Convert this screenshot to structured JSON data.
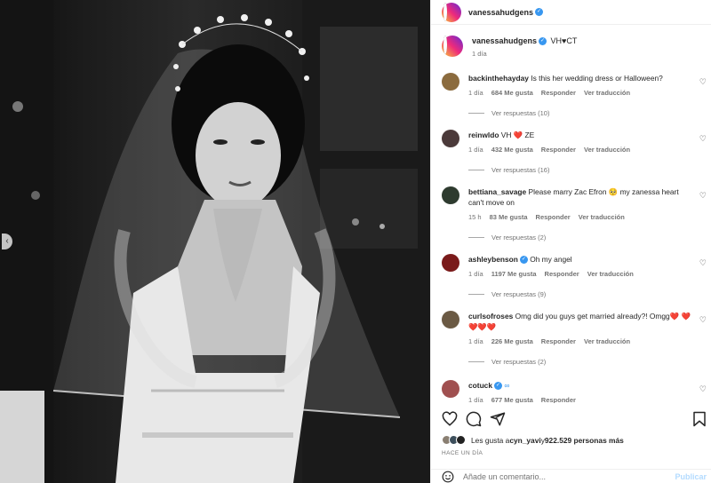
{
  "header": {
    "username": "vanessahudgens",
    "verified": true
  },
  "caption": {
    "username": "vanessahudgens",
    "text": "VH♥CT",
    "time": "1 día"
  },
  "comments": [
    {
      "username": "backinthehayday",
      "verified": false,
      "text": "Is this her wedding dress or Halloween?",
      "time": "1 día",
      "likes": "684 Me gusta",
      "reply": "Responder",
      "translate": "Ver traducción",
      "replies": "Ver respuestas (10)",
      "avatar_color": "#8b6b3e"
    },
    {
      "username": "reinwldo",
      "verified": false,
      "text": "VH ❤️ ZE",
      "time": "1 día",
      "likes": "432 Me gusta",
      "reply": "Responder",
      "translate": "Ver traducción",
      "replies": "Ver respuestas (16)",
      "avatar_color": "#4b3a3a"
    },
    {
      "username": "bettiana_savage",
      "verified": false,
      "text": "Please marry Zac Efron 🥺 my zanessa heart can't move on",
      "time": "15 h",
      "likes": "83 Me gusta",
      "reply": "Responder",
      "translate": "Ver traducción",
      "replies": "Ver respuestas (2)",
      "avatar_color": "#2e3b2f"
    },
    {
      "username": "ashleybenson",
      "verified": true,
      "text": "Oh my angel",
      "time": "1 día",
      "likes": "1197 Me gusta",
      "reply": "Responder",
      "translate": "Ver traducción",
      "replies": "Ver respuestas (9)",
      "avatar_color": "#7a1a1a"
    },
    {
      "username": "curlsofroses",
      "verified": false,
      "text": "Omg did you guys get married already?! Omgg❤️ ❤️❤️❤️❤️",
      "time": "1 día",
      "likes": "226 Me gusta",
      "reply": "Responder",
      "translate": "Ver traducción",
      "replies": "Ver respuestas (2)",
      "avatar_color": "#6b5a44"
    },
    {
      "username": "cotuck",
      "verified": true,
      "text": "∞",
      "time": "1 día",
      "likes": "677 Me gusta",
      "reply": "Responder",
      "translate": "",
      "replies": "",
      "avatar_color": "#a05050"
    }
  ],
  "likes_line": {
    "prefix": "Les gusta a ",
    "user": "cyn_yavi",
    "middle": " y ",
    "count": "922.529 personas más"
  },
  "post_date": "HACE UN DÍA",
  "add_comment": {
    "placeholder": "Añade un comentario...",
    "publish": "Publicar"
  },
  "colors": {
    "accent": "#3897f0",
    "heart": "#ed4956",
    "muted": "#737373"
  },
  "icons": [
    "heart-icon",
    "comment-icon",
    "share-icon",
    "save-icon",
    "emoji-icon"
  ]
}
